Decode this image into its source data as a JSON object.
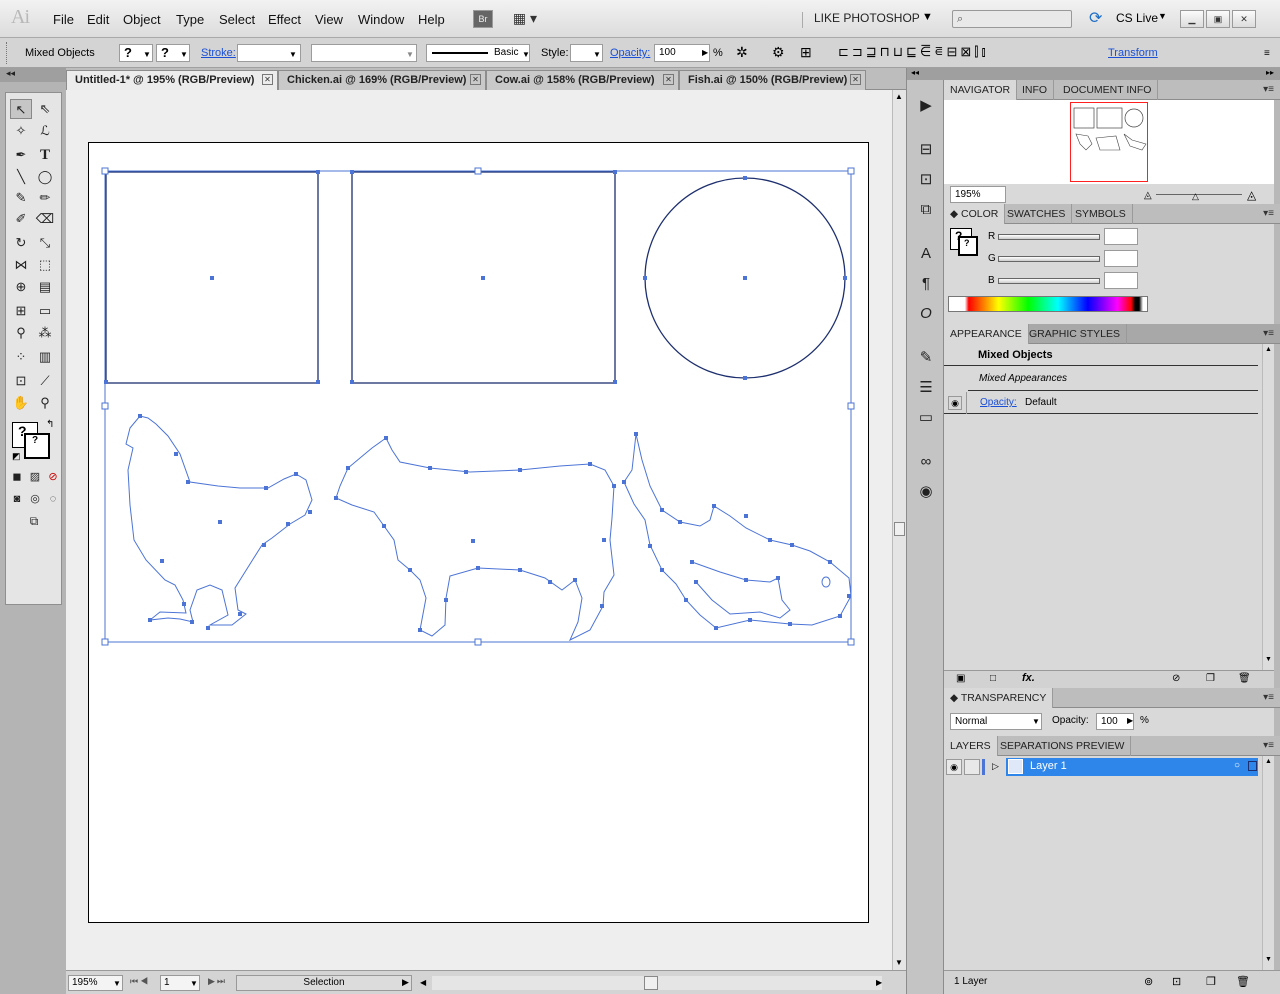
{
  "app": {
    "logo": "Ai"
  },
  "menu": [
    "File",
    "Edit",
    "Object",
    "Type",
    "Select",
    "Effect",
    "View",
    "Window",
    "Help"
  ],
  "workspace": {
    "label": "LIKE PHOTOSHOP",
    "bridge": "Br",
    "cslive": "CS Live"
  },
  "control": {
    "selection_label": "Mixed Objects",
    "stroke_label": "Stroke:",
    "brush_label": "Basic",
    "style_label": "Style:",
    "opacity_label": "Opacity:",
    "opacity_value": "100",
    "percent": "%",
    "transform_label": "Transform",
    "unknown": "?"
  },
  "tabs": [
    {
      "label": "Untitled-1* @ 195% (RGB/Preview)"
    },
    {
      "label": "Chicken.ai @ 169% (RGB/Preview)"
    },
    {
      "label": "Cow.ai @ 158% (RGB/Preview)"
    },
    {
      "label": "Fish.ai @ 150% (RGB/Preview)"
    }
  ],
  "status": {
    "zoom": "195%",
    "page": "1",
    "tool": "Selection"
  },
  "navigator": {
    "tabs": [
      "NAVIGATOR",
      "INFO",
      "DOCUMENT INFO"
    ],
    "zoom": "195%"
  },
  "color": {
    "tabs": [
      "COLOR",
      "SWATCHES",
      "SYMBOLS"
    ],
    "channels": [
      "R",
      "G",
      "B"
    ]
  },
  "appearance": {
    "tabs": [
      "APPEARANCE",
      "GRAPHIC STYLES"
    ],
    "title": "Mixed Objects",
    "mixed": "Mixed Appearances",
    "opacity_label": "Opacity:",
    "opacity_value": "Default",
    "fx": "fx."
  },
  "transparency": {
    "title": "TRANSPARENCY",
    "mode": "Normal",
    "opacity_label": "Opacity:",
    "opacity_value": "100",
    "percent": "%"
  },
  "layers": {
    "tabs": [
      "LAYERS",
      "SEPARATIONS PREVIEW"
    ],
    "items": [
      {
        "name": "Layer 1"
      }
    ],
    "count": "1 Layer"
  },
  "colors": {
    "selection": "#4c74d6",
    "layer_highlight": "#2f86ea"
  }
}
